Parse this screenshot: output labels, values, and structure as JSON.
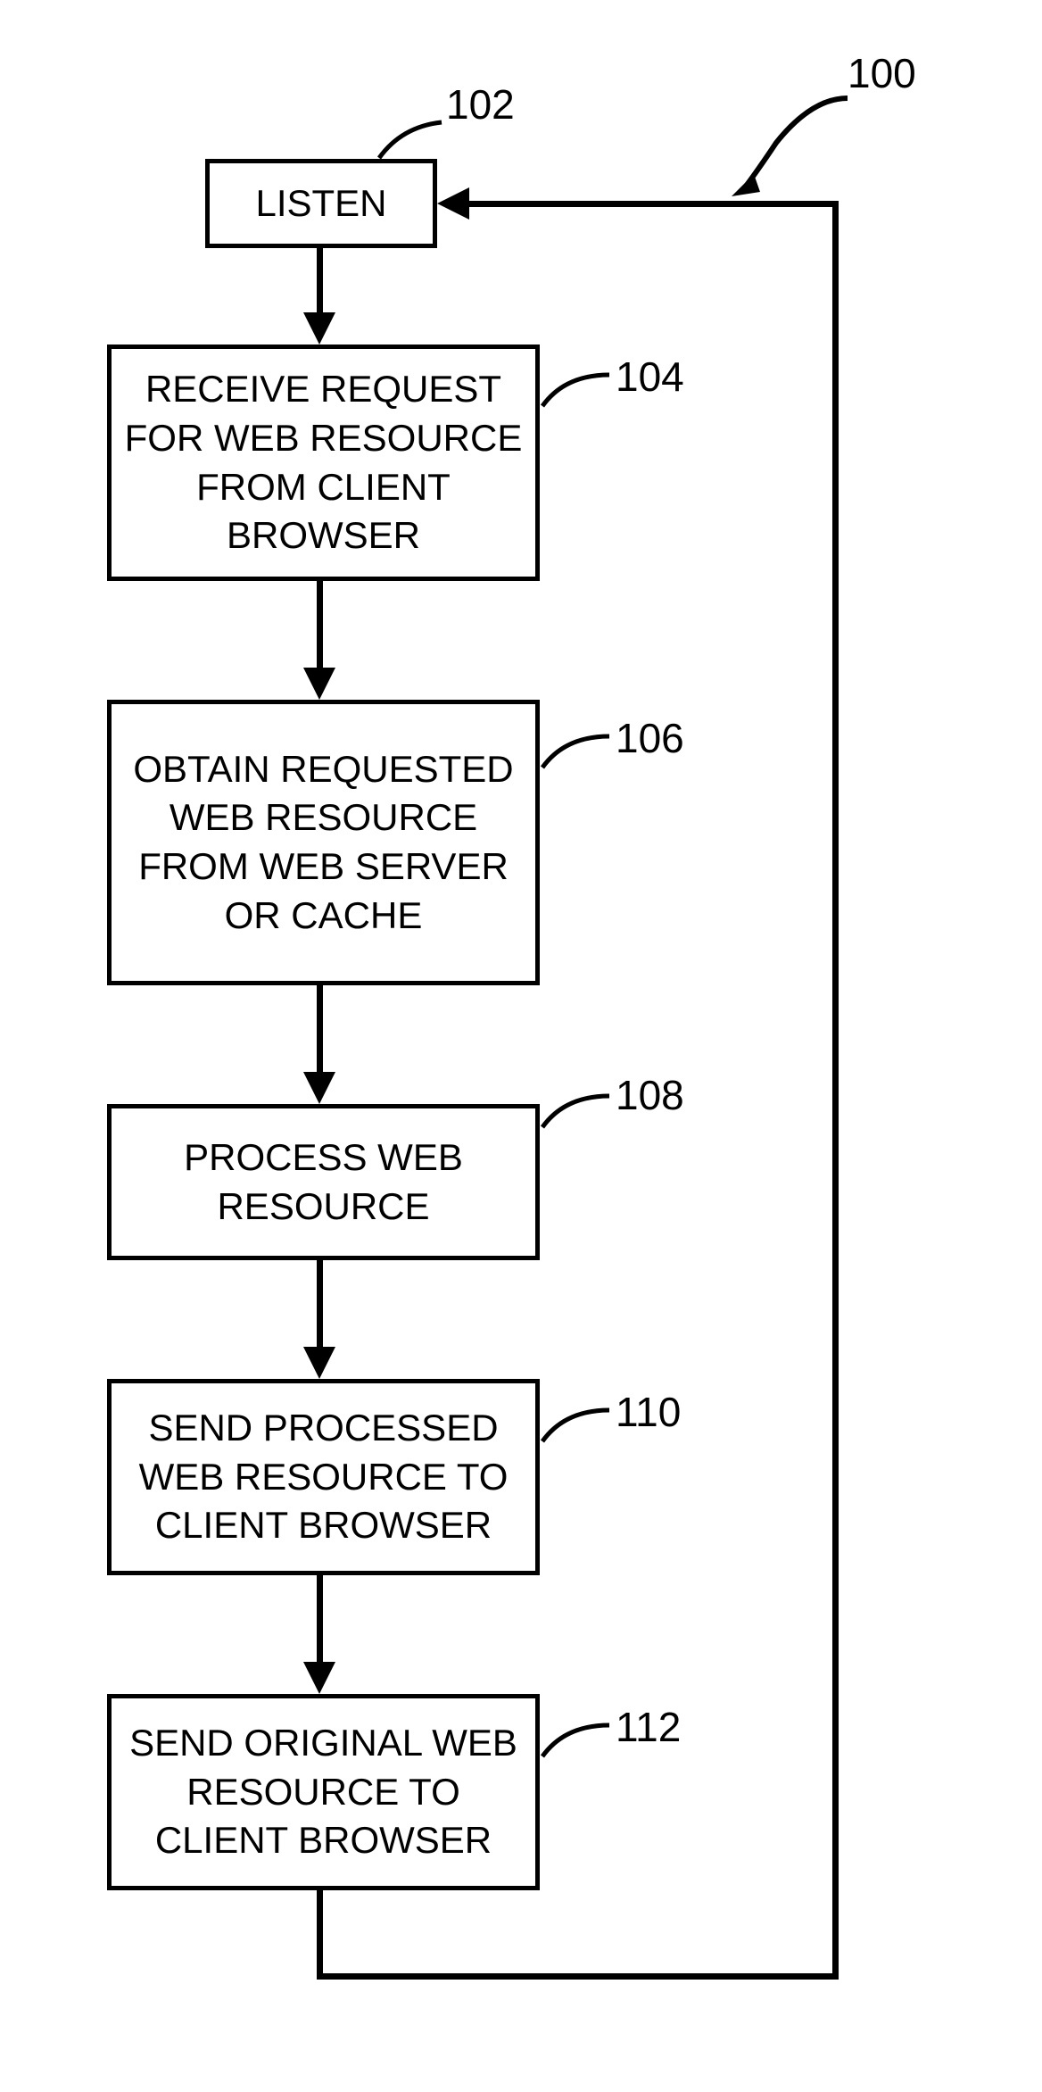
{
  "figure_ref": "100",
  "boxes": {
    "listen": {
      "label": "LISTEN",
      "ref": "102"
    },
    "receive": {
      "label": "RECEIVE REQUEST FOR WEB RESOURCE FROM CLIENT BROWSER",
      "ref": "104"
    },
    "obtain": {
      "label": "OBTAIN REQUESTED WEB RESOURCE FROM WEB SERVER OR CACHE",
      "ref": "106"
    },
    "process": {
      "label": "PROCESS WEB RESOURCE",
      "ref": "108"
    },
    "send_processed": {
      "label": "SEND PROCESSED WEB RESOURCE TO CLIENT BROWSER",
      "ref": "110"
    },
    "send_original": {
      "label": "SEND ORIGINAL WEB RESOURCE TO CLIENT BROWSER",
      "ref": "112"
    }
  }
}
